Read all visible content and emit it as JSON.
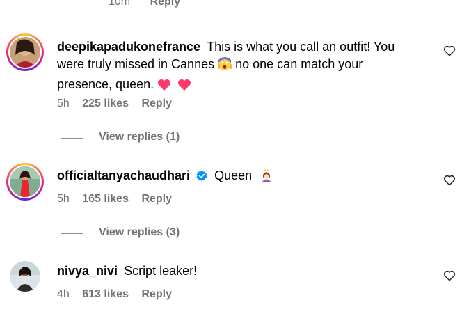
{
  "top": {
    "time": "10m",
    "reply": "Reply"
  },
  "comments": [
    {
      "username": "deepikapadukonefrance",
      "text_1": "This is what you call an outfit! You",
      "text_2": "were truly missed in Cannes",
      "text_3": "no one can match your",
      "text_4": "presence, queen.",
      "time": "5h",
      "likes": "225 likes",
      "reply": "Reply",
      "view_replies": "View replies (1)"
    },
    {
      "username": "officialtanyachaudhari",
      "text": "Queen",
      "time": "5h",
      "likes": "165 likes",
      "reply": "Reply",
      "view_replies": "View replies (3)"
    },
    {
      "username": "nivya_nivi",
      "text": "Script leaker!",
      "time": "4h",
      "likes": "613 likes",
      "reply": "Reply"
    }
  ],
  "colors": {
    "meta": "#737373",
    "verified": "#0095f6",
    "heart_emoji": "#ff3b6b"
  },
  "icons": [
    "heart-outline-icon",
    "verified-badge-icon",
    "screaming-face-emoji",
    "heart-emoji",
    "princess-emoji"
  ]
}
